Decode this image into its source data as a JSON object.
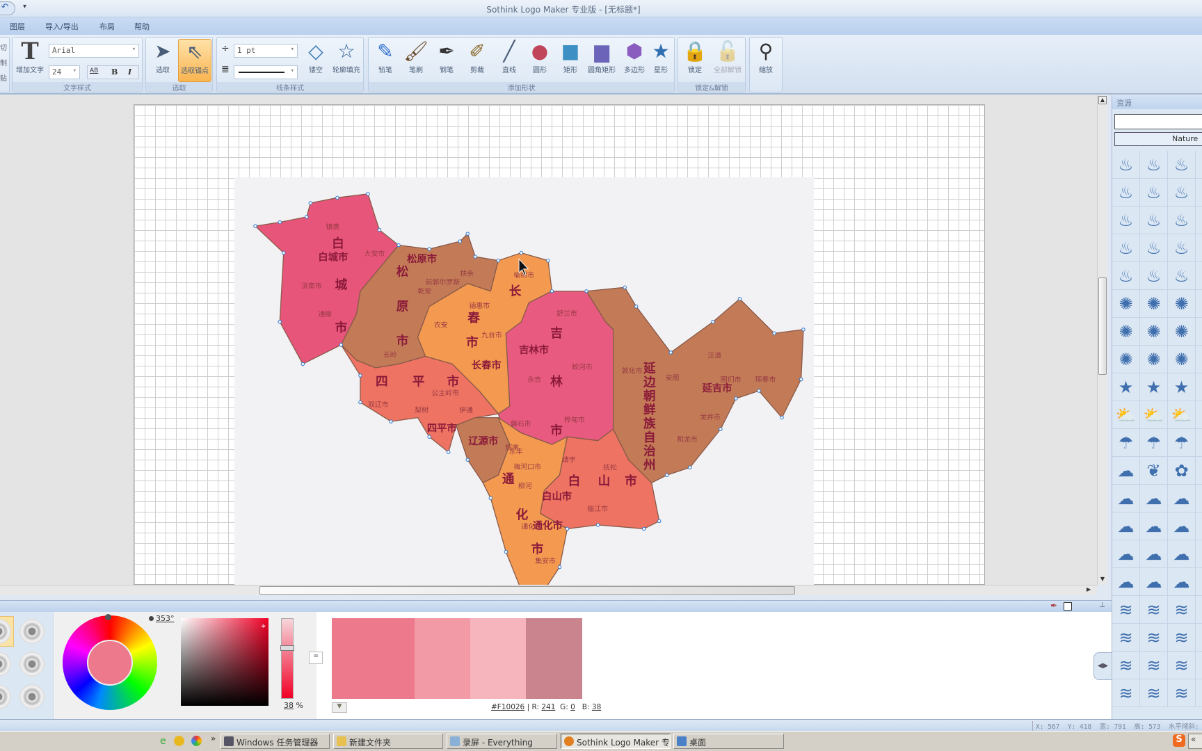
{
  "window": {
    "title": "Sothink Logo Maker 专业版 - [无标题*]"
  },
  "menu": [
    "图层",
    "导入/导出",
    "布局",
    "帮助"
  ],
  "clipboard_partial": [
    "切",
    "制",
    "贴"
  ],
  "text_group": {
    "label": "文字样式",
    "add_text": "增加文字",
    "font": "Arial",
    "size": "24",
    "spacing": "AB",
    "bold": "B",
    "italic": "I"
  },
  "select_group": {
    "label": "选取",
    "select": "选取",
    "select_anchor": "选取锚点"
  },
  "line_group": {
    "label": "线条样式",
    "width": "1 pt",
    "hollow": "镂空",
    "outline_fill": "轮廓填充"
  },
  "shape_group": {
    "label": "添加形状",
    "tools": [
      "铅笔",
      "笔刷",
      "钢笔",
      "剪裁",
      "直线",
      "圆形",
      "矩形",
      "圆角矩形",
      "多边形",
      "星形"
    ]
  },
  "lock_group": {
    "label": "锁定&解锁",
    "lock": "锁定",
    "unlock_all": "全部解锁"
  },
  "zoom_group": {
    "zoom": "缩放"
  },
  "map": {
    "colors": {
      "pink": "#e8557a",
      "brown": "#c27b56",
      "orange": "#f49a50",
      "salmon": "#ee7362"
    },
    "regions": [
      "白",
      "城",
      "市",
      "松",
      "原",
      "市",
      "长",
      "春",
      "市",
      "吉",
      "林",
      "市",
      "四",
      "平",
      "市",
      "通",
      "化",
      "市",
      "白",
      "山",
      "市",
      "延边朝鲜族自治州"
    ],
    "cities": [
      "白城市",
      "松原市",
      "长春市",
      "吉林市",
      "四平市",
      "辽源市",
      "通化市",
      "白山市",
      "延吉市"
    ],
    "counties": [
      "镇赉",
      "大安市",
      "洮南市",
      "通榆",
      "乾安",
      "前郭尔罗斯",
      "长岭",
      "扶余",
      "榆树市",
      "德惠市",
      "农安",
      "九台市",
      "舒兰市",
      "蛟河市",
      "永吉",
      "桦甸市",
      "磐石市",
      "公主岭市",
      "双辽市",
      "梨树",
      "伊通",
      "东丰",
      "梅河口市",
      "辉南",
      "柳河",
      "通化",
      "集安市",
      "靖宇",
      "抚松",
      "临江市",
      "敦化市",
      "安图",
      "汪清",
      "图们市",
      "珲春市",
      "龙井市",
      "和龙市"
    ]
  },
  "resources": {
    "title": "资源",
    "search": "",
    "category": "Nature",
    "icons": [
      "flame",
      "flame",
      "flame",
      "flame",
      "flame",
      "flame",
      "flame",
      "flame",
      "flame",
      "flame",
      "flame",
      "flame",
      "flame",
      "flame",
      "flame",
      "sun",
      "sun",
      "sun",
      "sun",
      "sun",
      "sun",
      "sun",
      "sun",
      "sun",
      "star",
      "star",
      "star",
      "cloud-sun",
      "cloud-sun",
      "cloud-sun",
      "cloud-rain",
      "cloud-rain",
      "cloud-rain",
      "cloud",
      "leaf",
      "flower",
      "cloud",
      "cloud",
      "cloud",
      "cloud",
      "cloud",
      "cloud",
      "cloud",
      "cloud",
      "cloud",
      "cloud",
      "cloud",
      "cloud",
      "wave",
      "wave",
      "wave",
      "wave",
      "wave",
      "wave",
      "wave",
      "wave",
      "wave",
      "wave",
      "wave",
      "wave"
    ]
  },
  "color_panel": {
    "hue": "353°",
    "alpha": "38",
    "alpha_unit": "%",
    "hex": "#F10026",
    "r_label": "R:",
    "r": "241",
    "g_label": "G:",
    "g": "0",
    "b_label": "B:",
    "b": "38",
    "current_color": "#f10026",
    "swatches": [
      "#ec7a8c",
      "#f29aa6",
      "#f6b4bd",
      "#c9848e"
    ]
  },
  "status": {
    "x_label": "X:",
    "x": "567",
    "y_label": "Y:",
    "y": "418",
    "w_label": "宽:",
    "w": "791",
    "h_label": "高:",
    "h": "573",
    "skew_label": "水平倾斜:"
  },
  "taskbar": {
    "items": [
      "Windows 任务管理器",
      "新建文件夹",
      "录屏 - Everything",
      "Sothink Logo Maker 专业...",
      "桌面"
    ],
    "more": "»",
    "tray_expand": "«"
  }
}
